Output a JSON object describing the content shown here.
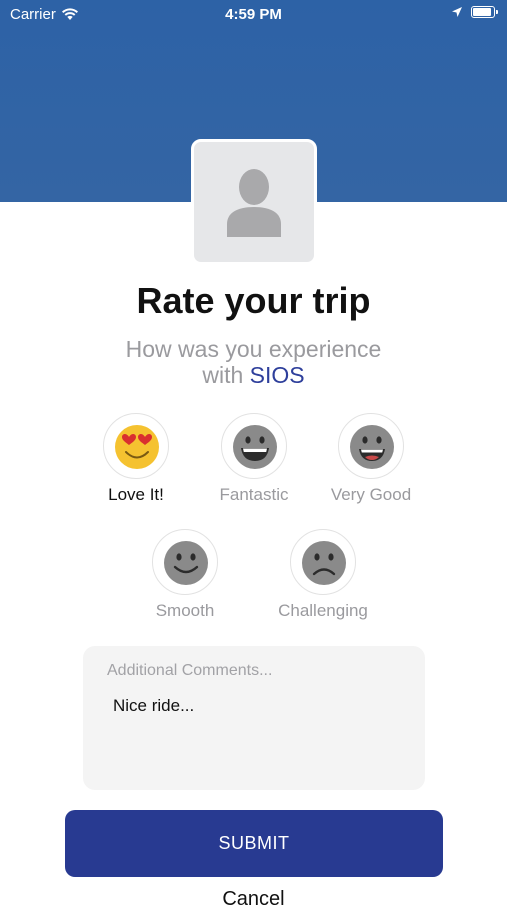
{
  "status_bar": {
    "carrier": "Carrier",
    "time": "4:59 PM"
  },
  "header": {
    "title": "Rate your trip",
    "subtitle_prefix": "How was you experience",
    "subtitle_with": "with",
    "brand": "SIOS",
    "brand_color": "#2e3f9b",
    "background_color": "#2d62a6"
  },
  "ratings": [
    {
      "label": "Love It!",
      "icon": "heart-eyes-emoji-icon",
      "selected": true
    },
    {
      "label": "Fantastic",
      "icon": "grinning-face-icon",
      "selected": false
    },
    {
      "label": "Very Good",
      "icon": "big-grin-face-icon",
      "selected": false
    },
    {
      "label": "Smooth",
      "icon": "smiling-face-icon",
      "selected": false
    },
    {
      "label": "Challenging",
      "icon": "frowning-face-icon",
      "selected": false
    }
  ],
  "comments": {
    "placeholder": "Additional Comments...",
    "value": "Nice ride..."
  },
  "actions": {
    "submit_label": "SUBMIT",
    "cancel_label": "Cancel",
    "submit_color": "#283a91"
  }
}
